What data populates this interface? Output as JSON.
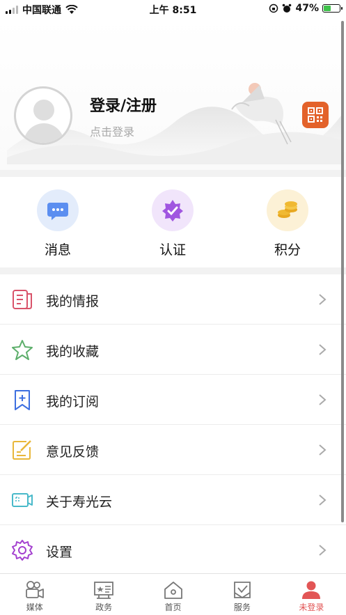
{
  "status_bar": {
    "carrier": "中国联通",
    "time": "上午 8:51",
    "battery_percent": "47%",
    "battery_level": 0.47
  },
  "profile": {
    "title": "登录/注册",
    "subtitle": "点击登录",
    "qr_icon": "qr-code-icon",
    "accent_color": "#e3622a"
  },
  "quick_actions": [
    {
      "label": "消息",
      "icon": "chat-bubble-icon",
      "color": "#5b8ef0"
    },
    {
      "label": "认证",
      "icon": "badge-check-icon",
      "color": "#a056e0"
    },
    {
      "label": "积分",
      "icon": "coins-icon",
      "color": "#f0b932"
    }
  ],
  "menu": [
    {
      "label": "我的情报",
      "icon": "newspaper-icon",
      "color": "#d9536a"
    },
    {
      "label": "我的收藏",
      "icon": "star-icon",
      "color": "#5cae6a"
    },
    {
      "label": "我的订阅",
      "icon": "bookmark-plus-icon",
      "color": "#3d6fe0"
    },
    {
      "label": "意见反馈",
      "icon": "edit-note-icon",
      "color": "#e8b73a"
    },
    {
      "label": "关于寿光云",
      "icon": "info-card-icon",
      "color": "#48b9c9"
    },
    {
      "label": "设置",
      "icon": "gear-icon",
      "color": "#a33fcf"
    }
  ],
  "tabs": [
    {
      "label": "媒体",
      "icon": "camera-icon",
      "active": false
    },
    {
      "label": "政务",
      "icon": "government-icon",
      "active": false
    },
    {
      "label": "首页",
      "icon": "home-icon",
      "active": false
    },
    {
      "label": "服务",
      "icon": "service-icon",
      "active": false
    },
    {
      "label": "未登录",
      "icon": "user-icon",
      "active": true
    }
  ]
}
